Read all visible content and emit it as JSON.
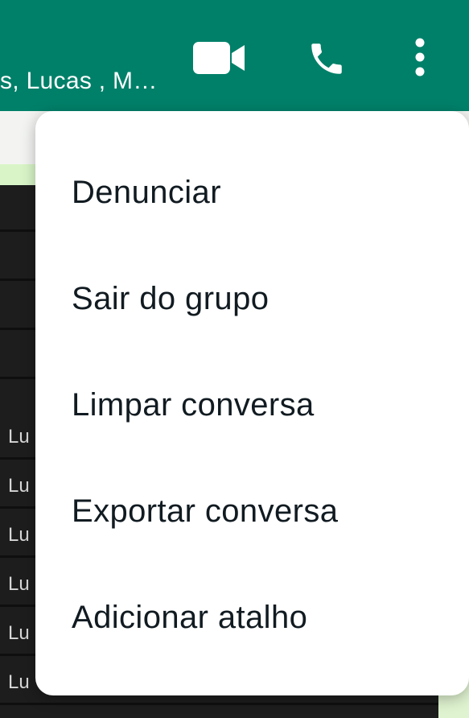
{
  "header": {
    "participants": "s, Lucas , M…",
    "video_call_icon": "video-camera-icon",
    "voice_call_icon": "phone-icon",
    "menu_icon": "more-vertical-icon"
  },
  "menu": {
    "items": [
      {
        "label": "Denunciar"
      },
      {
        "label": "Sair do grupo"
      },
      {
        "label": "Limpar conversa"
      },
      {
        "label": "Exportar conversa"
      },
      {
        "label": "Adicionar atalho"
      }
    ]
  },
  "chat": {
    "rows": [
      {
        "text": ""
      },
      {
        "text": ""
      },
      {
        "text": ""
      },
      {
        "text": ""
      },
      {
        "text": "Lu"
      },
      {
        "text": "Lu"
      },
      {
        "text": "Lu"
      },
      {
        "text": "Lu"
      },
      {
        "text": "Lu"
      },
      {
        "text": "Lu"
      }
    ]
  },
  "colors": {
    "header_bg": "#008069",
    "menu_bg": "#ffffff",
    "menu_text": "#111b21"
  }
}
